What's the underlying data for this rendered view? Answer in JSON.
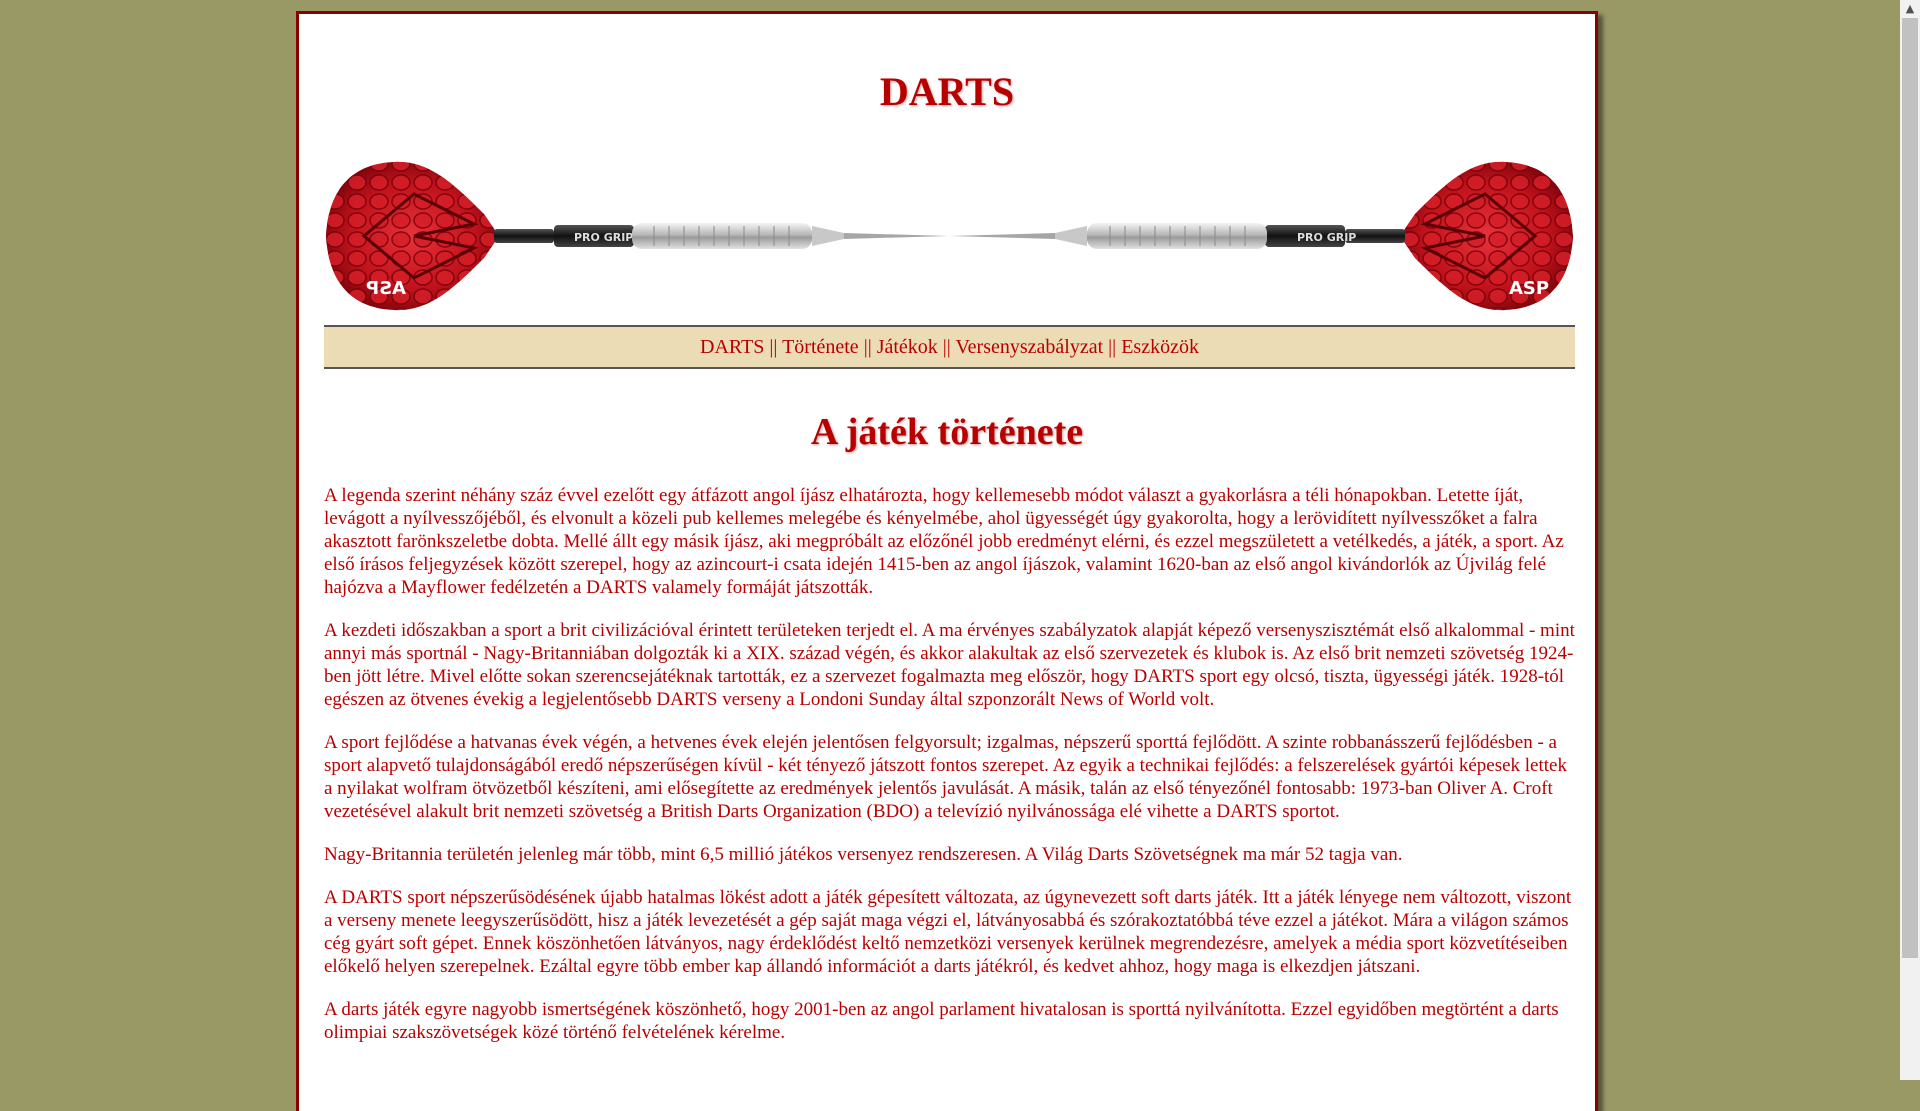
{
  "site": {
    "title": "DARTS"
  },
  "nav": {
    "items": [
      {
        "label": "DARTS"
      },
      {
        "label": "Története"
      },
      {
        "label": "Játékok"
      },
      {
        "label": "Versenyszabályzat"
      },
      {
        "label": "Eszközök"
      }
    ],
    "separator": "||"
  },
  "banner": {
    "left_grip_text": "PRO GRIP",
    "right_grip_text": "PRO GRIP",
    "flight_text": "ASP"
  },
  "article": {
    "title": "A játék története",
    "paragraphs": [
      "A legenda szerint néhány száz évvel ezelőtt egy átfázott angol íjász elhatározta, hogy kellemesebb módot választ a gyakorlásra a téli hónapokban. Letette íját, levágott a nyílvesszőjéből, és elvonult a közeli pub kellemes melegébe és kényelmébe, ahol ügyességét úgy gyakorolta, hogy a lerövidített nyílvesszőket a falra akasztott farönkszeletbe dobta. Mellé állt egy másik íjász, aki megpróbált az előzőnél jobb eredményt elérni, és ezzel megszületett a vetélkedés, a játék, a sport. Az első írásos feljegyzések között szerepel, hogy az azincourt-i csata idején 1415-ben az angol íjászok, valamint 1620-ban az első angol kivándorlók az Újvilág felé hajózva a Mayflower fedélzetén a DARTS valamely formáját játszották.",
      "A kezdeti időszakban a sport a brit civilizációval érintett területeken terjedt el. A ma érvényes szabályzatok alapját képező versenyszisztémát első alkalommal - mint annyi más sportnál - Nagy-Britanniában dolgozták ki a XIX. század végén, és akkor alakultak az első szervezetek és klubok is. Az első brit nemzeti szövetség 1924-ben jött létre. Mivel előtte sokan szerencsejátéknak tartották, ez a szervezet fogalmazta meg először, hogy DARTS sport egy olcsó, tiszta, ügyességi játék. 1928-tól egészen az ötvenes évekig a legjelentősebb DARTS verseny a Londoni Sunday által szponzorált News of World volt.",
      "A sport fejlődése a hatvanas évek végén, a hetvenes évek elején jelentősen felgyorsult; izgalmas, népszerű sporttá fejlődött. A szinte robbanásszerű fejlődésben - a sport alapvető tulajdonságából eredő népszerűségen kívül - két tényező játszott fontos szerepet. Az egyik a technikai fejlődés: a felszerelések gyártói képesek lettek a nyilakat wolfram ötvözetből készíteni, ami elősegítette az eredmények jelentős javulását. A másik, talán az első tényezőnél fontosabb: 1973-ban Oliver A. Croft vezetésével alakult brit nemzeti szövetség a British Darts Organization (BDO) a televízió nyilvánossága elé vihette a DARTS sportot.",
      "Nagy-Britannia területén jelenleg már több, mint 6,5 millió játékos versenyez rendszeresen. A Világ Darts Szövetségnek ma már 52 tagja van.",
      "A DARTS sport népszerűsödésének újabb hatalmas lökést adott a játék gépesített változata, az úgynevezett soft darts játék. Itt a játék lényege nem változott, viszont a verseny menete leegyszerűsödött, hisz a játék levezetését a gép saját maga végzi el, látványosabbá és szórakoztatóbbá téve ezzel a játékot. Mára a világon számos cég gyárt soft gépet. Ennek köszönhetően látványos, nagy érdeklődést keltő nemzetközi versenyek kerülnek megrendezésre, amelyek a média sport közvetítéseiben előkelő helyen szerepelnek. Ezáltal egyre több ember kap állandó információt a darts játékról, és kedvet ahhoz, hogy maga is elkezdjen játszani.",
      "A darts játék egyre nagyobb ismertségének köszönhető, hogy 2001-ben az angol parlament hivatalosan is sporttá nyilvánította. Ezzel egyidőben megtörtént a darts olimpiai szakszövetségek közé történő felvételének kérelme."
    ]
  },
  "colors": {
    "background": "#999966",
    "text": "#b80000",
    "nav_background": "#ecdcb6",
    "frame_border": "#8b0000"
  }
}
